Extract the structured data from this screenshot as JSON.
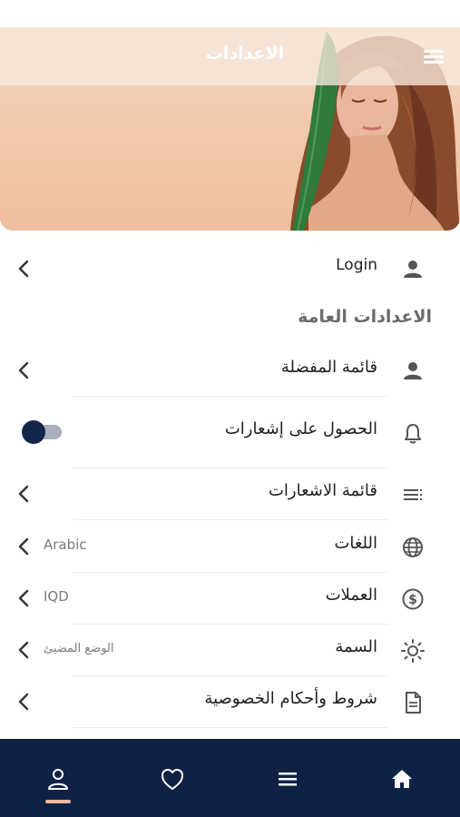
{
  "header": {
    "title": "الاعدادات",
    "menu_icon": "menu-icon"
  },
  "login": {
    "label": "Login",
    "icon": "person-icon"
  },
  "section": {
    "title": "الاعدادات العامة"
  },
  "settings": {
    "favorites": {
      "label": "قائمة المفضلة",
      "icon": "person-icon"
    },
    "notifications_toggle": {
      "label": "الحصول على إشعارات",
      "icon": "bell-icon",
      "enabled": false
    },
    "notifications_list": {
      "label": "قائمة الاشعارات",
      "icon": "list-icon"
    },
    "languages": {
      "label": "اللغات",
      "value": "Arabic",
      "icon": "globe-icon"
    },
    "currencies": {
      "label": "العملات",
      "value": "IQD",
      "icon": "dollar-icon"
    },
    "theme": {
      "label": "السمة",
      "value": "الوضع المضيئ",
      "icon": "sun-icon"
    },
    "terms": {
      "label": "شروط وأحكام الخصوصية",
      "icon": "document-icon"
    }
  },
  "bottom_nav": {
    "items": [
      {
        "name": "profile",
        "icon": "person-outline-icon",
        "active": true
      },
      {
        "name": "favorites",
        "icon": "heart-icon",
        "active": false
      },
      {
        "name": "menu",
        "icon": "menu-icon",
        "active": false
      },
      {
        "name": "home",
        "icon": "home-icon",
        "active": false
      }
    ]
  },
  "colors": {
    "nav_background": "#0f2246",
    "accent": "#f0b9a0",
    "toggle_knob": "#14274b",
    "toggle_track": "#a9afbe",
    "section_title": "#6b6b6b"
  }
}
